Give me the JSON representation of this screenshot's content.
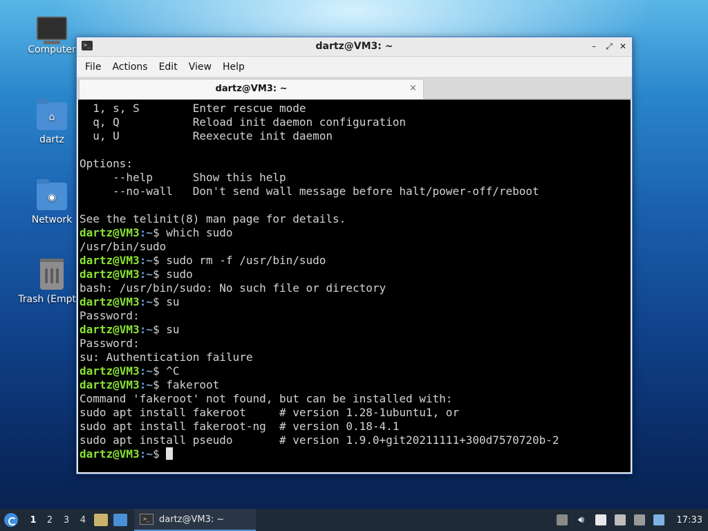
{
  "desktop": {
    "icons": [
      {
        "label": "Computer"
      },
      {
        "label": "dartz"
      },
      {
        "label": "Network"
      },
      {
        "label": "Trash (Empty)"
      }
    ]
  },
  "window": {
    "title": "dartz@VM3: ~",
    "menu": [
      "File",
      "Actions",
      "Edit",
      "View",
      "Help"
    ],
    "tab_label": "dartz@VM3: ~",
    "tab_close": "×"
  },
  "terminal": {
    "prompt_user": "dartz@VM3",
    "prompt_path": ":~",
    "prompt_symbol": "$ ",
    "lines": [
      {
        "text": "  1, s, S        Enter rescue mode"
      },
      {
        "text": "  q, Q           Reload init daemon configuration"
      },
      {
        "text": "  u, U           Reexecute init daemon"
      },
      {
        "text": ""
      },
      {
        "text": "Options:"
      },
      {
        "text": "     --help      Show this help"
      },
      {
        "text": "     --no-wall   Don't send wall message before halt/power-off/reboot"
      },
      {
        "text": ""
      },
      {
        "text": "See the telinit(8) man page for details."
      },
      {
        "cmd": "which sudo"
      },
      {
        "text": "/usr/bin/sudo"
      },
      {
        "cmd": "sudo rm -f /usr/bin/sudo"
      },
      {
        "cmd": "sudo"
      },
      {
        "text": "bash: /usr/bin/sudo: No such file or directory"
      },
      {
        "cmd": "su"
      },
      {
        "text": "Password:"
      },
      {
        "cmd": "su"
      },
      {
        "text": "Password:"
      },
      {
        "text": "su: Authentication failure"
      },
      {
        "cmd": "^C"
      },
      {
        "cmd": "fakeroot"
      },
      {
        "text": "Command 'fakeroot' not found, but can be installed with:"
      },
      {
        "text": "sudo apt install fakeroot     # version 1.28-1ubuntu1, or"
      },
      {
        "text": "sudo apt install fakeroot-ng  # version 0.18-4.1"
      },
      {
        "text": "sudo apt install pseudo       # version 1.9.0+git20211111+300d7570720b-2"
      },
      {
        "cmd": "",
        "cursor": true
      }
    ]
  },
  "taskbar": {
    "workspaces": [
      "1",
      "2",
      "3",
      "4"
    ],
    "active_workspace": "1",
    "task_label": "dartz@VM3: ~",
    "clock": "17:33"
  }
}
